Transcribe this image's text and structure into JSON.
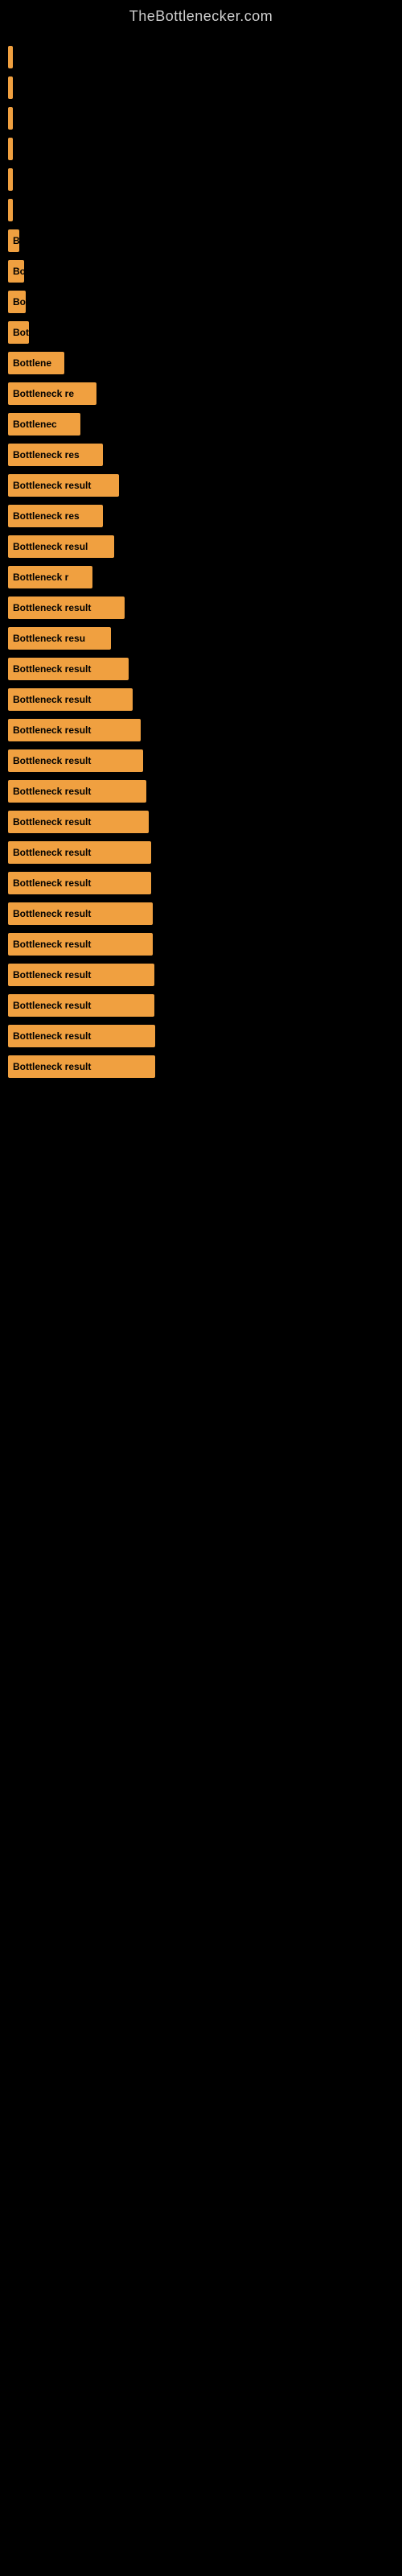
{
  "site": {
    "title": "TheBottlenecker.com"
  },
  "bars": [
    {
      "label": "",
      "width": 4
    },
    {
      "label": "",
      "width": 4
    },
    {
      "label": "",
      "width": 6
    },
    {
      "label": "",
      "width": 4
    },
    {
      "label": "",
      "width": 4
    },
    {
      "label": "",
      "width": 6
    },
    {
      "label": "B",
      "width": 14
    },
    {
      "label": "Bo",
      "width": 20
    },
    {
      "label": "Bo",
      "width": 22
    },
    {
      "label": "Bot",
      "width": 26
    },
    {
      "label": "Bottlene",
      "width": 70
    },
    {
      "label": "Bottleneck re",
      "width": 110
    },
    {
      "label": "Bottlenec",
      "width": 90
    },
    {
      "label": "Bottleneck res",
      "width": 118
    },
    {
      "label": "Bottleneck result",
      "width": 138
    },
    {
      "label": "Bottleneck res",
      "width": 118
    },
    {
      "label": "Bottleneck resul",
      "width": 132
    },
    {
      "label": "Bottleneck r",
      "width": 105
    },
    {
      "label": "Bottleneck result",
      "width": 145
    },
    {
      "label": "Bottleneck resu",
      "width": 128
    },
    {
      "label": "Bottleneck result",
      "width": 150
    },
    {
      "label": "Bottleneck result",
      "width": 155
    },
    {
      "label": "Bottleneck result",
      "width": 165
    },
    {
      "label": "Bottleneck result",
      "width": 168
    },
    {
      "label": "Bottleneck result",
      "width": 172
    },
    {
      "label": "Bottleneck result",
      "width": 175
    },
    {
      "label": "Bottleneck result",
      "width": 178
    },
    {
      "label": "Bottleneck result",
      "width": 178
    },
    {
      "label": "Bottleneck result",
      "width": 180
    },
    {
      "label": "Bottleneck result",
      "width": 180
    },
    {
      "label": "Bottleneck result",
      "width": 182
    },
    {
      "label": "Bottleneck result",
      "width": 182
    },
    {
      "label": "Bottleneck result",
      "width": 183
    },
    {
      "label": "Bottleneck result",
      "width": 183
    }
  ]
}
